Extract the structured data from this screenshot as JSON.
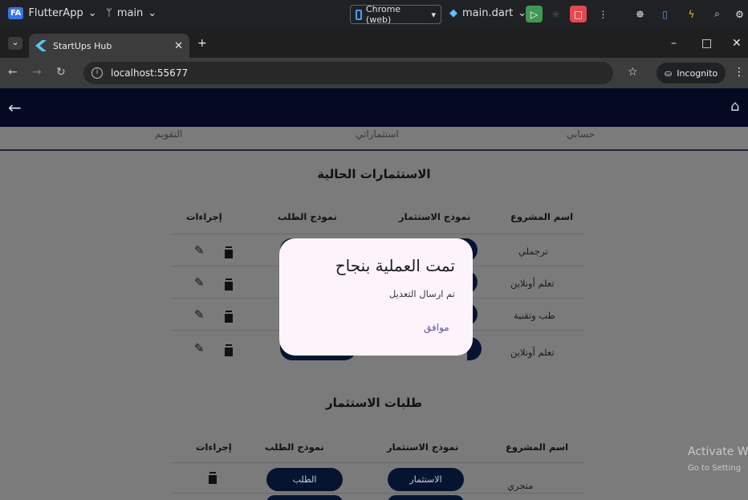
{
  "ide": {
    "project": "FlutterApp",
    "project_badge": "FA",
    "branch": "main",
    "device": "Chrome (web)",
    "run_config": "main.dart"
  },
  "browser": {
    "tab_title": "StartUps Hub",
    "url": "localhost:55677",
    "incognito_label": "Incognito"
  },
  "nav": {
    "tabs": [
      "التقويم",
      "استثماراتي",
      "حسابي"
    ]
  },
  "current_investments": {
    "title": "الاستثمارات الحالية",
    "headers": {
      "project_name": "اسم المشروع",
      "investment_form": "نموذج الاستثمار",
      "request_form": "نموذج الطلب",
      "actions": "إجراءات"
    },
    "rows": [
      {
        "project": "ترجملي"
      },
      {
        "project": "تعلم أونلاين"
      },
      {
        "project": "طب وتقنية"
      },
      {
        "project": "تعلم أونلاين"
      }
    ]
  },
  "investment_requests": {
    "title": "طلبات الاستثمار",
    "headers": {
      "project_name": "اسم المشروع",
      "investment_form": "نموذج الاستثمار",
      "request_form": "نموذج الطلب",
      "actions": "إجراءات"
    },
    "rows": [
      {
        "project": "متجري",
        "investment_btn": "الاستثمار",
        "request_btn": "الطلب"
      }
    ]
  },
  "dialog": {
    "title": "تمت العملية بنجاح",
    "message": "تم ارسال التعديل",
    "ok_label": "موافق"
  },
  "watermark": {
    "line1": "Activate W",
    "line2": "Go to Setting"
  }
}
